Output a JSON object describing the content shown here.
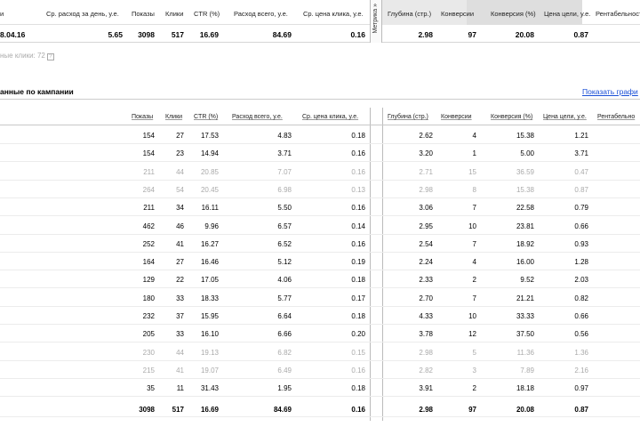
{
  "summary": {
    "headers": {
      "left": "и",
      "avg_spend_day": "Ср. расход за день, у.е.",
      "impressions": "Показы",
      "clicks": "Клики",
      "ctr": "CTR (%)",
      "spend_total": "Расход всего, у.е.",
      "avg_cpc": "Ср. цена клика, у.е.",
      "metrika": "Метрика »",
      "depth": "Глубина (стр.)",
      "conversions": "Конверсии",
      "conversion_rate": "Конверсия (%)",
      "goal_cost": "Цена цели, у.е.",
      "profitability": "Рентабельность"
    },
    "row": {
      "date": "8.04.16",
      "avg_spend_day": "5.65",
      "impressions": "3098",
      "clicks": "517",
      "ctr": "16.69",
      "spend_total": "84.69",
      "avg_cpc": "0.16",
      "depth": "2.98",
      "conversions": "97",
      "conversion_rate": "20.08",
      "goal_cost": "0.87"
    }
  },
  "hidden_clicks": {
    "label": "ные клики: 72",
    "help": "?"
  },
  "section": {
    "title": "анные по кампании",
    "show_link": "Показать графи"
  },
  "main": {
    "headers": {
      "impressions": "Показы",
      "clicks": "Клики",
      "ctr": "CTR (%)",
      "spend": "Расход всего, у.е.",
      "cpc": "Ср. цена клика, у.е.",
      "depth": "Глубина (стр.)",
      "conversions": "Конверсии",
      "conversion_rate": "Конверсия (%)",
      "goal_cost": "Цена цели, у.е.",
      "profitability": "Рентабельно"
    },
    "rows": [
      {
        "imp": "154",
        "clk": "27",
        "ctr": "17.53",
        "sp": "4.83",
        "cpc": "0.18",
        "dep": "2.62",
        "conv": "4",
        "cr": "15.38",
        "gc": "1.21",
        "dim": false
      },
      {
        "imp": "154",
        "clk": "23",
        "ctr": "14.94",
        "sp": "3.71",
        "cpc": "0.16",
        "dep": "3.20",
        "conv": "1",
        "cr": "5.00",
        "gc": "3.71",
        "dim": false
      },
      {
        "imp": "211",
        "clk": "44",
        "ctr": "20.85",
        "sp": "7.07",
        "cpc": "0.16",
        "dep": "2.71",
        "conv": "15",
        "cr": "36.59",
        "gc": "0.47",
        "dim": true
      },
      {
        "imp": "264",
        "clk": "54",
        "ctr": "20.45",
        "sp": "6.98",
        "cpc": "0.13",
        "dep": "2.98",
        "conv": "8",
        "cr": "15.38",
        "gc": "0.87",
        "dim": true
      },
      {
        "imp": "211",
        "clk": "34",
        "ctr": "16.11",
        "sp": "5.50",
        "cpc": "0.16",
        "dep": "3.06",
        "conv": "7",
        "cr": "22.58",
        "gc": "0.79",
        "dim": false
      },
      {
        "imp": "462",
        "clk": "46",
        "ctr": "9.96",
        "sp": "6.57",
        "cpc": "0.14",
        "dep": "2.95",
        "conv": "10",
        "cr": "23.81",
        "gc": "0.66",
        "dim": false
      },
      {
        "imp": "252",
        "clk": "41",
        "ctr": "16.27",
        "sp": "6.52",
        "cpc": "0.16",
        "dep": "2.54",
        "conv": "7",
        "cr": "18.92",
        "gc": "0.93",
        "dim": false
      },
      {
        "imp": "164",
        "clk": "27",
        "ctr": "16.46",
        "sp": "5.12",
        "cpc": "0.19",
        "dep": "2.24",
        "conv": "4",
        "cr": "16.00",
        "gc": "1.28",
        "dim": false
      },
      {
        "imp": "129",
        "clk": "22",
        "ctr": "17.05",
        "sp": "4.06",
        "cpc": "0.18",
        "dep": "2.33",
        "conv": "2",
        "cr": "9.52",
        "gc": "2.03",
        "dim": false
      },
      {
        "imp": "180",
        "clk": "33",
        "ctr": "18.33",
        "sp": "5.77",
        "cpc": "0.17",
        "dep": "2.70",
        "conv": "7",
        "cr": "21.21",
        "gc": "0.82",
        "dim": false
      },
      {
        "imp": "232",
        "clk": "37",
        "ctr": "15.95",
        "sp": "6.64",
        "cpc": "0.18",
        "dep": "4.33",
        "conv": "10",
        "cr": "33.33",
        "gc": "0.66",
        "dim": false
      },
      {
        "imp": "205",
        "clk": "33",
        "ctr": "16.10",
        "sp": "6.66",
        "cpc": "0.20",
        "dep": "3.78",
        "conv": "12",
        "cr": "37.50",
        "gc": "0.56",
        "dim": false
      },
      {
        "imp": "230",
        "clk": "44",
        "ctr": "19.13",
        "sp": "6.82",
        "cpc": "0.15",
        "dep": "2.98",
        "conv": "5",
        "cr": "11.36",
        "gc": "1.36",
        "dim": true
      },
      {
        "imp": "215",
        "clk": "41",
        "ctr": "19.07",
        "sp": "6.49",
        "cpc": "0.16",
        "dep": "2.82",
        "conv": "3",
        "cr": "7.89",
        "gc": "2.16",
        "dim": true
      },
      {
        "imp": "35",
        "clk": "11",
        "ctr": "31.43",
        "sp": "1.95",
        "cpc": "0.18",
        "dep": "3.91",
        "conv": "2",
        "cr": "18.18",
        "gc": "0.97",
        "dim": false
      }
    ],
    "total": {
      "imp": "3098",
      "clk": "517",
      "ctr": "16.69",
      "sp": "84.69",
      "cpc": "0.16",
      "dep": "2.98",
      "conv": "97",
      "cr": "20.08",
      "gc": "0.87"
    }
  }
}
